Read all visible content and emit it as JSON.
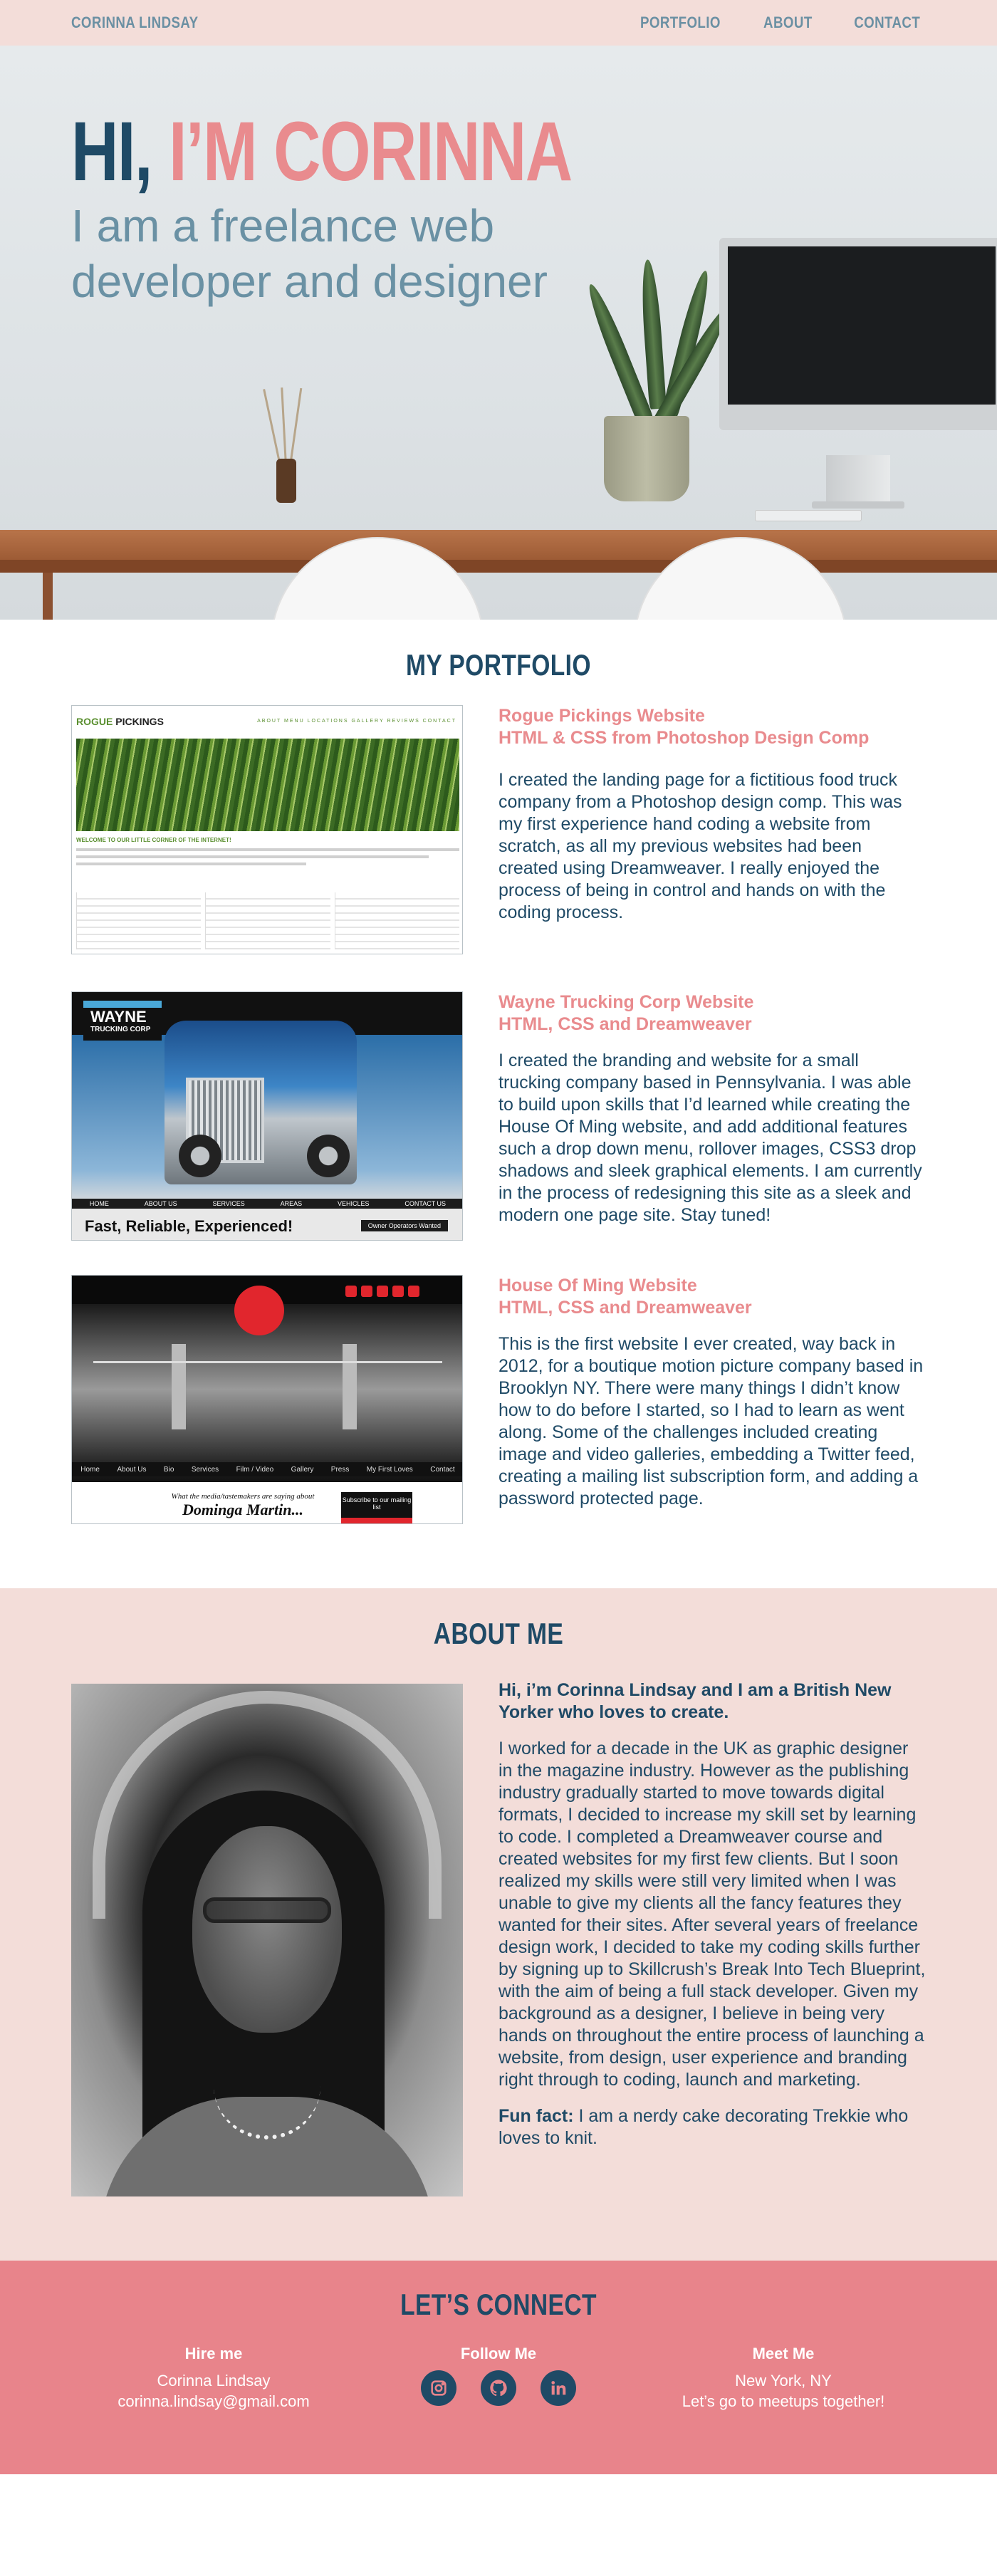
{
  "header": {
    "brand": "CORINNA LINDSAY",
    "nav": [
      "PORTFOLIO",
      "ABOUT",
      "CONTACT"
    ]
  },
  "hero": {
    "greeting": "HI, ",
    "name": "I’M CORINNA",
    "subtitle": "I am a freelance web developer and designer"
  },
  "portfolio": {
    "title": "MY PORTFOLIO",
    "projects": [
      {
        "title": "Rogue Pickings Website",
        "subtitle": "HTML & CSS from Photoshop Design Comp",
        "description": "I created the landing page for a fictitious food truck company from a Photoshop design comp. This was my first experience hand coding a website from scratch, as all my previous websites had been created using Dreamweaver. I really enjoyed the process of being in control and hands on with the coding process.",
        "thumb": {
          "brand_a": "ROGUE ",
          "brand_b": "PICKINGS",
          "nav": "ABOUT  MENU  LOCATIONS  GALLERY  REVIEWS  CONTACT",
          "heading": "WELCOME TO OUR LITTLE CORNER OF THE INTERNET!"
        }
      },
      {
        "title": "Wayne Trucking Corp Website",
        "subtitle": "HTML, CSS and Dreamweaver",
        "description": "I created the branding and website for a small trucking company based in Pennsylvania. I was able to build upon skills that I’d learned while creating the House Of Ming website, and add additional features such a drop down menu, rollover images, CSS3 drop shadows and sleek graphical elements. I am currently in the process of redesigning this site as a sleek and modern one page site. Stay tuned!",
        "thumb": {
          "logo": "WAYNE",
          "logo_sub": "TRUCKING CORP",
          "nav": [
            "HOME",
            "ABOUT US",
            "SERVICES",
            "AREAS",
            "VEHICLES",
            "CONTACT US"
          ],
          "tagline": "Fast, Reliable, Experienced!",
          "button": "Owner Operators Wanted"
        }
      },
      {
        "title": "House Of Ming Website",
        "subtitle": "HTML, CSS and Dreamweaver",
        "description": "This is the first website I ever created, way back in 2012, for a boutique motion picture company based in Brooklyn NY. There were many things I didn’t know how to do before I started, so I had to learn as went along. Some of the challenges included creating image and video galleries, embedding a Twitter feed, creating a mailing list subscription form, and adding a password protected page.",
        "thumb": {
          "nav": [
            "Home",
            "About Us",
            "Bio",
            "Services",
            "Film / Video",
            "Gallery",
            "Press",
            "My First Loves",
            "Contact"
          ],
          "quote_small": "What the media/tastemakers are saying about",
          "quote_name": "Dominga Martin...",
          "subscribe": "Subscribe to our mailing list"
        }
      }
    ]
  },
  "about": {
    "title": "ABOUT ME",
    "lead": "Hi, i’m Corinna Lindsay and I am a British New Yorker who loves to create.",
    "body": "I worked for a decade in the UK as graphic designer in the magazine industry. However as the publishing industry gradually started to move towards digital formats, I decided to increase my skill set by learning to code. I completed a Dreamweaver course and created websites for my first few clients. But I soon realized my skills were still very limited when I was unable to give my clients all the fancy features they wanted for their sites. After several years of freelance design work, I decided to take my coding skills further by signing up to Skillcrush’s Break Into Tech Blueprint, with the aim of being a full stack developer. Given my background as a designer, I believe in being very hands on throughout the entire process of launching a website, from design, user experience and branding right through to coding, launch and marketing.",
    "fun_label": "Fun fact:",
    "fun_text": " I am a nerdy cake decorating Trekkie who loves to knit."
  },
  "connect": {
    "title": "LET’S CONNECT",
    "hire": {
      "heading": "Hire me",
      "name": "Corinna Lindsay",
      "email": "corinna.lindsay@gmail.com"
    },
    "follow": {
      "heading": "Follow Me",
      "icons": [
        "instagram-icon",
        "github-icon",
        "linkedin-icon"
      ]
    },
    "meet": {
      "heading": "Meet Me",
      "location": "New York, NY",
      "note": "Let’s go to meetups together!"
    }
  },
  "colors": {
    "header_bg": "#f3ddd9",
    "navy": "#1f4a66",
    "pink": "#e98b8e",
    "steel_blue": "#6b90a3",
    "connect_bg": "#e8848b"
  }
}
